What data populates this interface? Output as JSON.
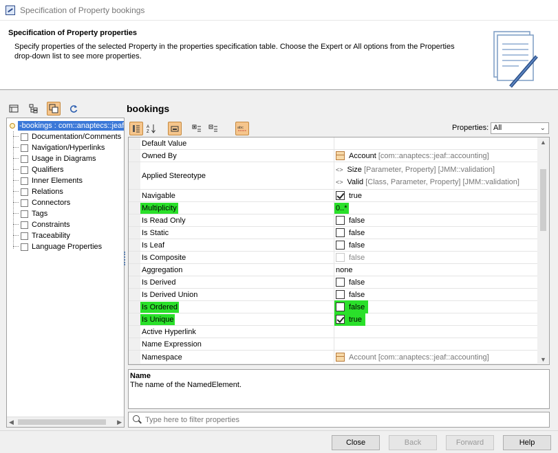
{
  "window": {
    "title": "Specification of Property bookings"
  },
  "header": {
    "title": "Specification of Property properties",
    "description": "Specify properties of the selected Property in the properties specification table. Choose the Expert or All options from the Properties drop-down list to see more properties."
  },
  "tree": {
    "root": "-bookings : com::anaptecs::jeaf",
    "items": [
      "Documentation/Comments",
      "Navigation/Hyperlinks",
      "Usage in Diagrams",
      "Qualifiers",
      "Inner Elements",
      "Relations",
      "Connectors",
      "Tags",
      "Constraints",
      "Traceability",
      "Language Properties"
    ]
  },
  "panel": {
    "title": "bookings",
    "properties_label": "Properties:",
    "properties_value": "All"
  },
  "table": {
    "rows": [
      {
        "name": "Default Value",
        "value": ""
      },
      {
        "name": "Owned By",
        "value": "Account",
        "value_extra": "[com::anaptecs::jeaf::accounting]"
      },
      {
        "name": "Applied Stereotype",
        "value": "Size",
        "value_extra": "[Parameter, Property] [JMM::validation]",
        "value2": "Valid",
        "value2_extra": "[Class, Parameter, Property] [JMM::validation]"
      },
      {
        "name": "Navigable",
        "value": "true"
      },
      {
        "name": "Multiplicity",
        "value": "0..*"
      },
      {
        "name": "Is Read Only",
        "value": "false"
      },
      {
        "name": "Is Static",
        "value": "false"
      },
      {
        "name": "Is Leaf",
        "value": "false"
      },
      {
        "name": "Is Composite",
        "value": "false"
      },
      {
        "name": "Aggregation",
        "value": "none"
      },
      {
        "name": "Is Derived",
        "value": "false"
      },
      {
        "name": "Is Derived Union",
        "value": "false"
      },
      {
        "name": "Is Ordered",
        "value": "false"
      },
      {
        "name": "Is Unique",
        "value": "true"
      },
      {
        "name": "Active Hyperlink",
        "value": ""
      },
      {
        "name": "Name Expression",
        "value": ""
      },
      {
        "name": "Namespace",
        "value": "Account",
        "value_extra": "[com::anaptecs::jeaf::accounting]"
      }
    ]
  },
  "description": {
    "title": "Name",
    "text": "The name of the NamedElement."
  },
  "filter": {
    "placeholder": "Type here to filter properties"
  },
  "buttons": {
    "close": "Close",
    "back": "Back",
    "forward": "Forward",
    "help": "Help"
  },
  "colors": {
    "highlight": "#2ae02a",
    "selection": "#3b78d8",
    "active_tool": "#f5c58c"
  }
}
